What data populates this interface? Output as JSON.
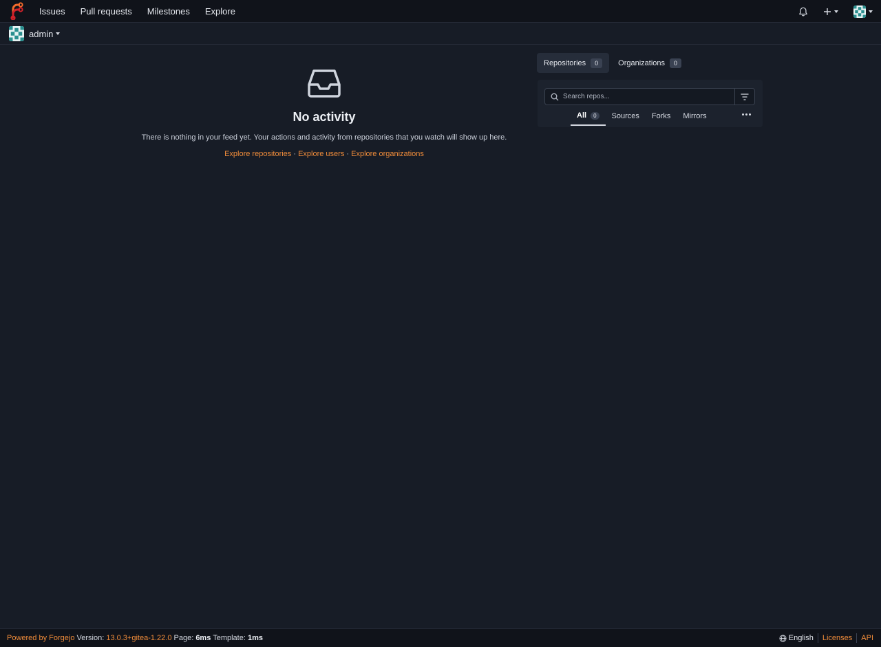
{
  "colors": {
    "accent": "#f08c3a",
    "background": "#171c26",
    "navbar": "#10131a"
  },
  "nav": {
    "links": [
      "Issues",
      "Pull requests",
      "Milestones",
      "Explore"
    ],
    "icons": [
      "bell-icon",
      "plus-icon",
      "avatar"
    ]
  },
  "context": {
    "user": "admin"
  },
  "feed": {
    "title": "No activity",
    "description": "There is nothing in your feed yet. Your actions and activity from repositories that you watch will show up here.",
    "link_repositories": "Explore repositories",
    "link_users": "Explore users",
    "link_organizations": "Explore organizations",
    "separator": " · "
  },
  "dashboard": {
    "tab_repositories": "Repositories",
    "tab_repositories_count": "0",
    "tab_organizations": "Organizations",
    "tab_organizations_count": "0",
    "search_placeholder": "Search repos...",
    "filter_all": "All",
    "filter_all_count": "0",
    "filter_sources": "Sources",
    "filter_forks": "Forks",
    "filter_mirrors": "Mirrors"
  },
  "footer": {
    "powered_by": "Powered by Forgejo",
    "version_label": "Version:",
    "version": "13.0.3+gitea-1.22.0",
    "page_label": "Page:",
    "page_time": "6ms",
    "template_label": "Template:",
    "template_time": "1ms",
    "language": "English",
    "licenses": "Licenses",
    "api": "API"
  }
}
